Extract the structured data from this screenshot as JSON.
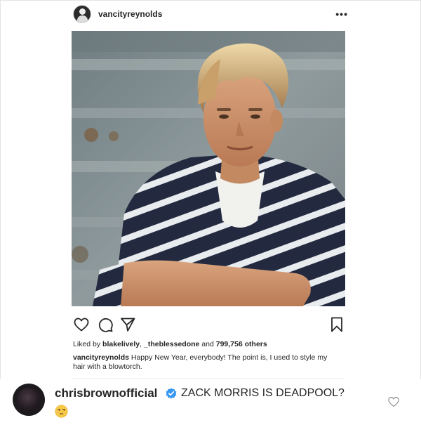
{
  "post": {
    "username": "vancityreynolds",
    "more_label": "•••"
  },
  "photo": {
    "icon": "photo-of-young-man-in-striped-shirt"
  },
  "actions": {
    "like_icon": "heart-outline-icon",
    "comment_icon": "comment-bubble-icon",
    "share_icon": "paper-plane-icon",
    "save_icon": "bookmark-icon"
  },
  "likes": {
    "prefix": "Liked by",
    "user1": "blakelively",
    "separator": ",",
    "user2": "_theblessedone",
    "middle": "and",
    "count": "799,756 others"
  },
  "caption": {
    "username": "vancityreynolds",
    "text": "Happy New Year, everybody! The point is, I used to style my hair with a blowtorch."
  },
  "comment": {
    "username": "chrisbrownofficial",
    "verified_icon": "verified-badge-icon",
    "text": "ZACK MORRIS IS DEADPOOL?",
    "emoji": "unamused-face-emoji",
    "like_icon": "heart-outline-icon"
  },
  "colors": {
    "text": "#262626",
    "verified": "#3897f0",
    "emoji": "#f7c948",
    "border": "#e4e4e4"
  }
}
